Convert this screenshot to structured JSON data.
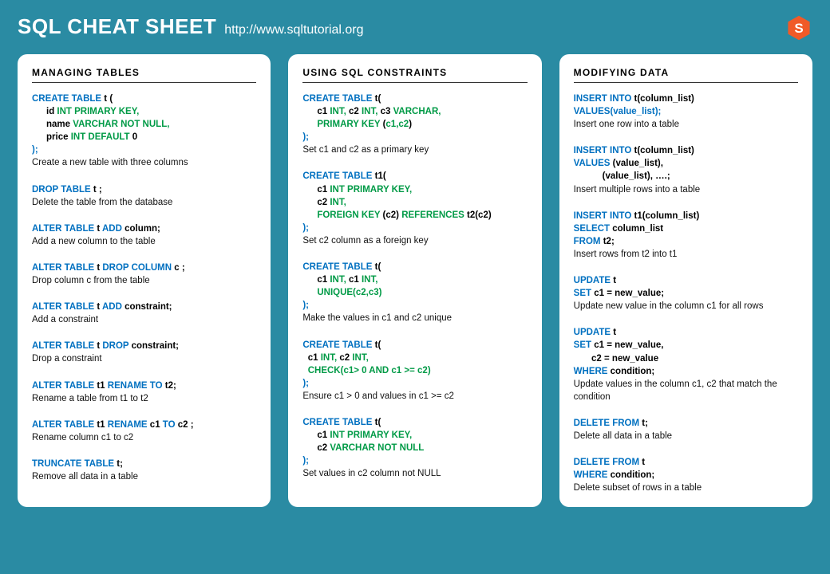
{
  "header": {
    "title": "SQL CHEAT SHEET",
    "url": "http://www.sqltutorial.org"
  },
  "columns": [
    {
      "heading": "MANAGING TABLES",
      "items": [
        {
          "code": [
            [
              {
                "t": "CREATE TABLE ",
                "c": "blue"
              },
              {
                "t": "t (",
                "c": "black"
              }
            ],
            [
              {
                "indent": 1
              },
              {
                "t": "id ",
                "c": "black"
              },
              {
                "t": "INT PRIMARY KEY,",
                "c": "green"
              }
            ],
            [
              {
                "indent": 1
              },
              {
                "t": "name ",
                "c": "black"
              },
              {
                "t": "VARCHAR NOT NULL,",
                "c": "green"
              }
            ],
            [
              {
                "indent": 1
              },
              {
                "t": "price ",
                "c": "black"
              },
              {
                "t": "INT DEFAULT ",
                "c": "green"
              },
              {
                "t": "0",
                "c": "black"
              }
            ],
            [
              {
                "t": ");",
                "c": "blue"
              }
            ]
          ],
          "desc": "Create a new table with three columns"
        },
        {
          "code": [
            [
              {
                "t": "DROP TABLE ",
                "c": "blue"
              },
              {
                "t": "t ;",
                "c": "black"
              }
            ]
          ],
          "desc": "Delete the table from the database"
        },
        {
          "code": [
            [
              {
                "t": "ALTER TABLE ",
                "c": "blue"
              },
              {
                "t": "t ",
                "c": "black"
              },
              {
                "t": "ADD ",
                "c": "blue"
              },
              {
                "t": "column;",
                "c": "black"
              }
            ]
          ],
          "desc": "Add a new column to the table"
        },
        {
          "code": [
            [
              {
                "t": "ALTER TABLE ",
                "c": "blue"
              },
              {
                "t": "t ",
                "c": "black"
              },
              {
                "t": "DROP COLUMN ",
                "c": "blue"
              },
              {
                "t": "c ;",
                "c": "black"
              }
            ]
          ],
          "desc": "Drop column c from the table"
        },
        {
          "code": [
            [
              {
                "t": "ALTER TABLE ",
                "c": "blue"
              },
              {
                "t": "t ",
                "c": "black"
              },
              {
                "t": "ADD ",
                "c": "blue"
              },
              {
                "t": "constraint;",
                "c": "black"
              }
            ]
          ],
          "desc": "Add a constraint"
        },
        {
          "code": [
            [
              {
                "t": "ALTER TABLE ",
                "c": "blue"
              },
              {
                "t": "t ",
                "c": "black"
              },
              {
                "t": "DROP ",
                "c": "blue"
              },
              {
                "t": "constraint;",
                "c": "black"
              }
            ]
          ],
          "desc": "Drop a constraint"
        },
        {
          "code": [
            [
              {
                "t": "ALTER TABLE ",
                "c": "blue"
              },
              {
                "t": "t1 ",
                "c": "black"
              },
              {
                "t": "RENAME TO ",
                "c": "blue"
              },
              {
                "t": "t2;",
                "c": "black"
              }
            ]
          ],
          "desc": "Rename a table from t1 to t2"
        },
        {
          "code": [
            [
              {
                "t": "ALTER TABLE ",
                "c": "blue"
              },
              {
                "t": "t1 ",
                "c": "black"
              },
              {
                "t": "RENAME ",
                "c": "blue"
              },
              {
                "t": "c1 ",
                "c": "black"
              },
              {
                "t": "TO ",
                "c": "blue"
              },
              {
                "t": "c2 ;",
                "c": "black"
              }
            ]
          ],
          "desc": "Rename column c1 to c2"
        },
        {
          "code": [
            [
              {
                "t": "TRUNCATE TABLE ",
                "c": "blue"
              },
              {
                "t": "t;",
                "c": "black"
              }
            ]
          ],
          "desc": "Remove all data in a table"
        }
      ]
    },
    {
      "heading": "USING SQL CONSTRAINTS",
      "items": [
        {
          "code": [
            [
              {
                "t": "CREATE TABLE ",
                "c": "blue"
              },
              {
                "t": "t(",
                "c": "black"
              }
            ],
            [
              {
                "indent": 1
              },
              {
                "t": "c1 ",
                "c": "black"
              },
              {
                "t": "INT, ",
                "c": "green"
              },
              {
                "t": "c2 ",
                "c": "black"
              },
              {
                "t": "INT, ",
                "c": "green"
              },
              {
                "t": "c3 ",
                "c": "black"
              },
              {
                "t": "VARCHAR,",
                "c": "green"
              }
            ],
            [
              {
                "indent": 1
              },
              {
                "t": "PRIMARY KEY ",
                "c": "green"
              },
              {
                "t": "(",
                "c": "black"
              },
              {
                "t": "c1,c2",
                "c": "green"
              },
              {
                "t": ")",
                "c": "black"
              }
            ],
            [
              {
                "t": ");",
                "c": "blue"
              }
            ]
          ],
          "desc": "Set c1 and c2 as a primary key"
        },
        {
          "code": [
            [
              {
                "t": "CREATE TABLE ",
                "c": "blue"
              },
              {
                "t": "t1(",
                "c": "black"
              }
            ],
            [
              {
                "indent": 1
              },
              {
                "t": "c1 ",
                "c": "black"
              },
              {
                "t": "INT PRIMARY KEY,",
                "c": "green"
              }
            ],
            [
              {
                "indent": 1
              },
              {
                "t": "c2 ",
                "c": "black"
              },
              {
                "t": "INT,",
                "c": "green"
              }
            ],
            [
              {
                "indent": 1
              },
              {
                "t": "FOREIGN KEY ",
                "c": "green"
              },
              {
                "t": "(c2) ",
                "c": "black"
              },
              {
                "t": "REFERENCES ",
                "c": "green"
              },
              {
                "t": "t2(c2)",
                "c": "black"
              }
            ],
            [
              {
                "t": ");",
                "c": "blue"
              }
            ]
          ],
          "desc": "Set c2 column as a foreign key"
        },
        {
          "code": [
            [
              {
                "t": "CREATE TABLE ",
                "c": "blue"
              },
              {
                "t": "t(",
                "c": "black"
              }
            ],
            [
              {
                "indent": 1
              },
              {
                "t": "c1 ",
                "c": "black"
              },
              {
                "t": "INT, ",
                "c": "green"
              },
              {
                "t": "c1 ",
                "c": "black"
              },
              {
                "t": "INT,",
                "c": "green"
              }
            ],
            [
              {
                "indent": 1
              },
              {
                "t": "UNIQUE(c2,c3)",
                "c": "green"
              }
            ],
            [
              {
                "t": ");",
                "c": "blue"
              }
            ]
          ],
          "desc": "Make the values in c1 and c2 unique"
        },
        {
          "code": [
            [
              {
                "t": "CREATE TABLE ",
                "c": "blue"
              },
              {
                "t": "t(",
                "c": "black"
              }
            ],
            [
              {
                "t": "  c1 ",
                "c": "black"
              },
              {
                "t": "INT, ",
                "c": "green"
              },
              {
                "t": "c2 ",
                "c": "black"
              },
              {
                "t": "INT,",
                "c": "green"
              }
            ],
            [
              {
                "t": "  ",
                "c": "black"
              },
              {
                "t": "CHECK(c1> 0 AND c1 >= c2)",
                "c": "green"
              }
            ],
            [
              {
                "t": ");",
                "c": "blue"
              }
            ]
          ],
          "desc": "Ensure c1 > 0 and values in c1 >= c2"
        },
        {
          "code": [
            [
              {
                "t": "CREATE TABLE ",
                "c": "blue"
              },
              {
                "t": "t(",
                "c": "black"
              }
            ],
            [
              {
                "indent": 1
              },
              {
                "t": "c1 ",
                "c": "black"
              },
              {
                "t": "INT PRIMARY KEY,",
                "c": "green"
              }
            ],
            [
              {
                "indent": 1
              },
              {
                "t": "c2 ",
                "c": "black"
              },
              {
                "t": "VARCHAR NOT NULL",
                "c": "green"
              }
            ],
            [
              {
                "t": ");",
                "c": "blue"
              }
            ]
          ],
          "desc": "Set values in c2 column not NULL"
        }
      ]
    },
    {
      "heading": "MODIFYING DATA",
      "items": [
        {
          "code": [
            [
              {
                "t": "INSERT INTO ",
                "c": "blue"
              },
              {
                "t": "t(column_list)",
                "c": "black"
              }
            ],
            [
              {
                "t": "VALUES(value_list);",
                "c": "blue"
              }
            ]
          ],
          "desc": "Insert one row into a table"
        },
        {
          "code": [
            [
              {
                "t": "INSERT INTO ",
                "c": "blue"
              },
              {
                "t": "t(column_list)",
                "c": "black"
              }
            ],
            [
              {
                "t": "VALUES ",
                "c": "blue"
              },
              {
                "t": "(value_list),",
                "c": "black"
              }
            ],
            [
              {
                "indent": 2
              },
              {
                "t": "(value_list), ….;",
                "c": "black"
              }
            ]
          ],
          "desc": "Insert multiple rows into a table"
        },
        {
          "code": [
            [
              {
                "t": "INSERT INTO ",
                "c": "blue"
              },
              {
                "t": "t1(column_list)",
                "c": "black"
              }
            ],
            [
              {
                "t": "SELECT ",
                "c": "blue"
              },
              {
                "t": "column_list",
                "c": "black"
              }
            ],
            [
              {
                "t": "FROM ",
                "c": "blue"
              },
              {
                "t": "t2;",
                "c": "black"
              }
            ]
          ],
          "desc": "Insert rows from t2 into t1"
        },
        {
          "code": [
            [
              {
                "t": "UPDATE ",
                "c": "blue"
              },
              {
                "t": "t",
                "c": "black"
              }
            ],
            [
              {
                "t": "SET ",
                "c": "blue"
              },
              {
                "t": "c1 = new_value;",
                "c": "black"
              }
            ]
          ],
          "desc": "Update new value in the column c1 for all rows"
        },
        {
          "code": [
            [
              {
                "t": "UPDATE ",
                "c": "blue"
              },
              {
                "t": "t",
                "c": "black"
              }
            ],
            [
              {
                "t": "SET ",
                "c": "blue"
              },
              {
                "t": "c1 = new_value,",
                "c": "black"
              }
            ],
            [
              {
                "t": "       c2 = new_value",
                "c": "black"
              }
            ],
            [
              {
                "t": "WHERE ",
                "c": "blue"
              },
              {
                "t": "condition;",
                "c": "black"
              }
            ]
          ],
          "desc": "Update values in the column c1, c2 that match the condition"
        },
        {
          "code": [
            [
              {
                "t": "DELETE FROM ",
                "c": "blue"
              },
              {
                "t": "t;",
                "c": "black"
              }
            ]
          ],
          "desc": "Delete all data in a table"
        },
        {
          "code": [
            [
              {
                "t": "DELETE FROM ",
                "c": "blue"
              },
              {
                "t": "t",
                "c": "black"
              }
            ],
            [
              {
                "t": "WHERE ",
                "c": "blue"
              },
              {
                "t": "condition;",
                "c": "black"
              }
            ]
          ],
          "desc": "Delete subset of rows in a table"
        }
      ]
    }
  ]
}
